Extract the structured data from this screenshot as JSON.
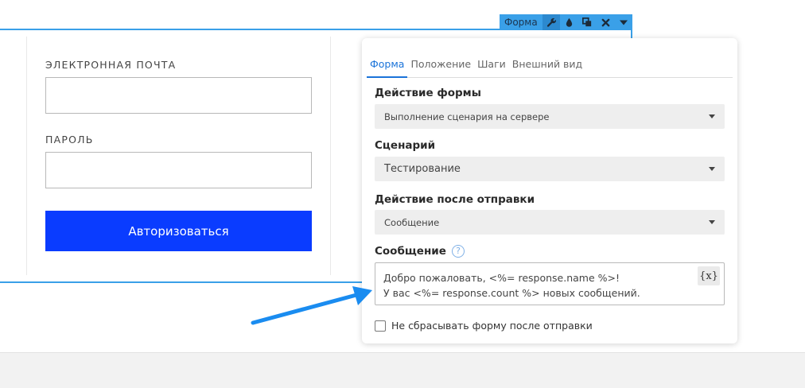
{
  "login_form": {
    "email_label": "ЭЛЕКТРОННАЯ ПОЧТА",
    "email_value": "",
    "password_label": "ПАРОЛЬ",
    "password_value": "",
    "submit_label": "Авторизоваться",
    "submit_color": "#0a3cff"
  },
  "toolbar": {
    "label": "Форма",
    "color": "#3aa0e8",
    "buttons": [
      "wrench-icon",
      "drop-icon",
      "duplicate-icon",
      "close-icon",
      "caret-down-icon"
    ]
  },
  "panel": {
    "tabs": [
      {
        "label": "Форма",
        "active": true
      },
      {
        "label": "Положение",
        "active": false
      },
      {
        "label": "Шаги",
        "active": false
      },
      {
        "label": "Внешний вид",
        "active": false
      }
    ],
    "form_action": {
      "label": "Действие формы",
      "value": "Выполнение сценария на сервере"
    },
    "scenario": {
      "label": "Сценарий",
      "value": "Тестирование"
    },
    "after_submit": {
      "label": "Действие после отправки",
      "value": "Сообщение"
    },
    "message": {
      "label": "Сообщение",
      "help_glyph": "?",
      "line1": "Добро пожаловать, <%= response.name %>!",
      "line2": "У вас <%= response.count %> новых сообщений.",
      "var_button": "{x}"
    },
    "keep_form": {
      "label": "Не сбрасывать форму после отправки",
      "checked": false
    }
  },
  "colors": {
    "accent": "#1a73d9",
    "selection": "#3aa0e8",
    "arrow": "#1a8cf0"
  }
}
